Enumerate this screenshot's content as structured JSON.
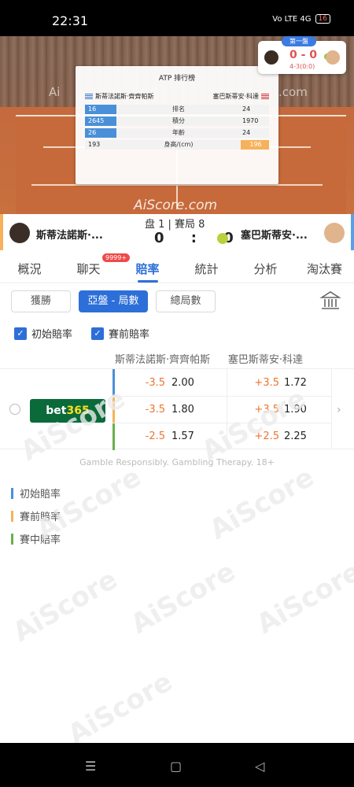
{
  "statusbar": {
    "time": "22:31",
    "icons": "Vo LTE 4G",
    "battery": "16"
  },
  "court": {
    "watermark": "AiScore.com",
    "side_wm_left": "Ai",
    "side_wm_right": ".com"
  },
  "atp": {
    "title": "ATP 排行榜",
    "player1": "斯蒂法諾斯·齊齊帕斯",
    "player2": "塞巴斯蒂安·科達",
    "rows": [
      {
        "left": "16",
        "label": "排名",
        "right": "24"
      },
      {
        "left": "2645",
        "label": "積分",
        "right": "1970"
      },
      {
        "left": "26",
        "label": "年齡",
        "right": "24"
      },
      {
        "left": "193",
        "label": "身高/(cm)",
        "right": "196"
      }
    ]
  },
  "scorebadge": {
    "set_label": "第一盤",
    "score": "0 - 0",
    "sub": "4-3(0:0)"
  },
  "match": {
    "p1": "斯蒂法諾斯·...",
    "p2": "塞巴斯蒂安·...",
    "info": "盘 1 | 賽局 8",
    "score": "0 : 0"
  },
  "tabs": [
    {
      "label": "概況"
    },
    {
      "label": "聊天"
    },
    {
      "label": "賠率"
    },
    {
      "label": "統計"
    },
    {
      "label": "分析"
    },
    {
      "label": "淘汰賽"
    }
  ],
  "chat_badge": "9999+",
  "filters": [
    {
      "label": "獲勝"
    },
    {
      "label": "亞盤 - 局數"
    },
    {
      "label": "總局數"
    }
  ],
  "checks": [
    {
      "label": "初始賠率"
    },
    {
      "label": "賽前賠率"
    }
  ],
  "headers": {
    "p1": "斯蒂法諾斯·齊齊帕斯",
    "p2": "塞巴斯蒂安·科達"
  },
  "bookmaker": {
    "name_a": "bet",
    "name_b": "365"
  },
  "odds": [
    {
      "h1": "-3.5",
      "o1": "2.00",
      "h2": "+3.5",
      "o2": "1.72",
      "color": "#4a90d9"
    },
    {
      "h1": "-3.5",
      "o1": "1.80",
      "h2": "+3.5",
      "o2": "1.90",
      "color": "#f5b25b"
    },
    {
      "h1": "-2.5",
      "o1": "1.57",
      "h2": "+2.5",
      "o2": "2.25",
      "color": "#6ab04c"
    }
  ],
  "footer": "Gamble Responsibly. Gambling Therapy. 18+",
  "legend": [
    {
      "label": "初始賠率",
      "color": "#4a90d9"
    },
    {
      "label": "賽前賠率",
      "color": "#f5b25b"
    },
    {
      "label": "賽中賠率",
      "color": "#6ab04c"
    }
  ],
  "wm": "AiScore"
}
